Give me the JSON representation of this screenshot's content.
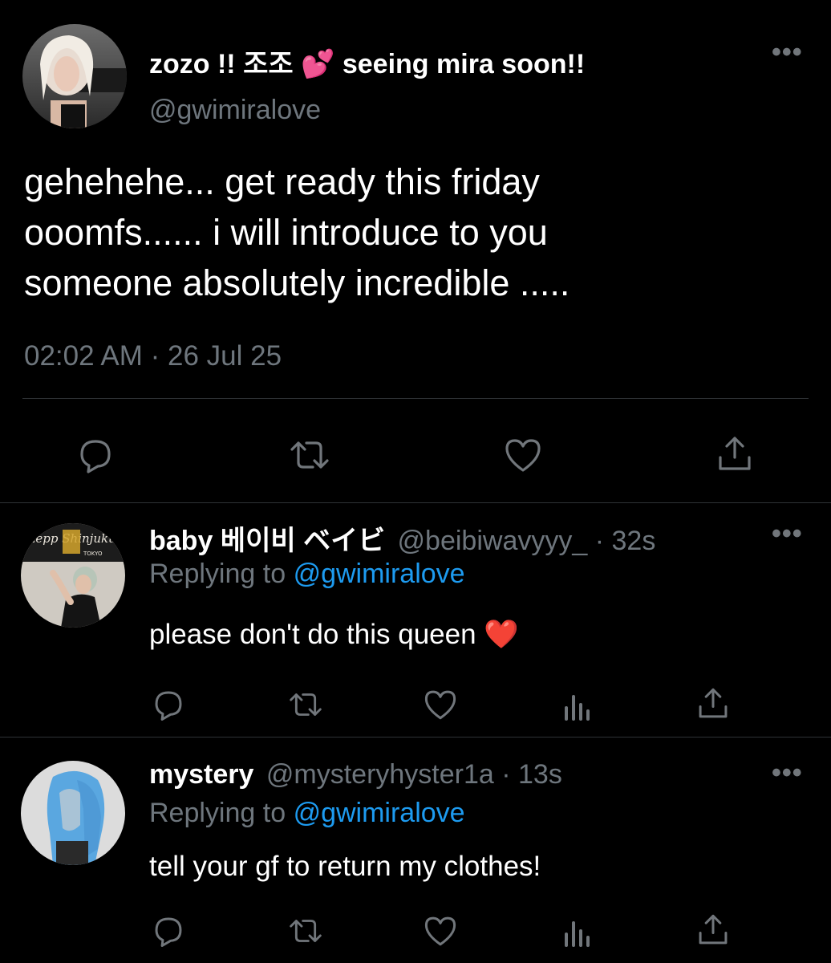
{
  "main_tweet": {
    "display_name": "zozo !! 조조 💕 seeing mira soon!!",
    "handle": "@gwimiralove",
    "text_lines": [
      "gehehehe... get ready this friday",
      "ooomfs...... i will introduce to you",
      "someone absolutely incredible ....."
    ],
    "timestamp": "02:02 AM · 26 Jul 25",
    "more_icon": "more-horizontal-icon"
  },
  "replies": [
    {
      "display_name": "baby 베이비 ベイビ",
      "handle": "@beibiwavyyy_",
      "time": "· 32s",
      "replying_prefix": "Replying to",
      "replying_handle": "@gwimiralove",
      "text": "please don't do this queen ❤️",
      "avatar_sign": "Zepp Shinjuku",
      "avatar_sign_sub": "TOKYO"
    },
    {
      "display_name": "mystery",
      "handle": "@mysteryhyster1a",
      "time": "· 13s",
      "replying_prefix": "Replying to",
      "replying_handle": "@gwimiralove",
      "text": "tell your gf to return my clothes!"
    }
  ],
  "colors": {
    "background": "#000000",
    "text": "#ffffff",
    "muted": "#6e767d",
    "link": "#1d9bf0",
    "divider": "#2f3336"
  }
}
